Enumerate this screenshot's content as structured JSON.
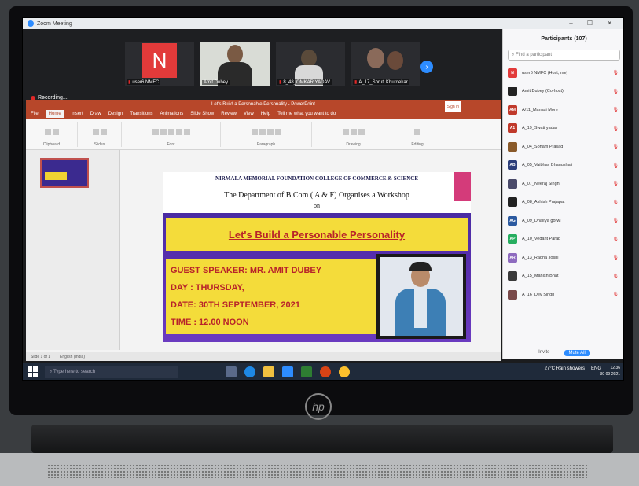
{
  "zoom": {
    "title": "Zoom Meeting",
    "recording": "Recording..."
  },
  "gallery": {
    "tiles": [
      {
        "initial": "N",
        "name": "user6 NMFC"
      },
      {
        "name": "Amit Dubey"
      },
      {
        "name": "8_48_OMKAR YADAV"
      },
      {
        "name": "A_17_Shruti Khurdekar"
      }
    ]
  },
  "ppt": {
    "window_title": "Let's Build a Personable Personality - PowerPoint",
    "signin": "Sign in",
    "tabs": [
      "File",
      "Home",
      "Insert",
      "Draw",
      "Design",
      "Transitions",
      "Animations",
      "Slide Show",
      "Review",
      "View",
      "Help",
      "Tell me what you want to do"
    ],
    "ribbon_groups": [
      "Clipboard",
      "Slides",
      "Font",
      "Paragraph",
      "Drawing",
      "Editing"
    ],
    "status": [
      "Slide 1 of 1",
      "English (India)"
    ]
  },
  "slide": {
    "college": "NIRMALA MEMORIAL FOUNDATION COLLEGE OF COMMERCE & SCIENCE",
    "dept": "The Department of B.Com ( A & F) Organises a Workshop",
    "on": "on",
    "workshop": "Let's Build a Personable Personality",
    "guest": "GUEST SPEAKER:  MR. AMIT DUBEY",
    "day": "DAY : THURSDAY,",
    "date": "DATE: 30TH SEPTEMBER, 2021",
    "time": "TIME : 12.00 NOON"
  },
  "participants": {
    "title": "Participants (107)",
    "search_placeholder": "Find a participant",
    "list": [
      {
        "initials": "N",
        "name": "user6 NMFC (Host, me)",
        "color": "#e23a3a"
      },
      {
        "initials": "",
        "name": "Amit Dubey (Co-host)",
        "color": "#222222"
      },
      {
        "initials": "AM",
        "name": "A/11_Manasi More",
        "color": "#c0392b"
      },
      {
        "initials": "A1",
        "name": "A_19_Swati yadav",
        "color": "#c0392b"
      },
      {
        "initials": "",
        "name": "A_04_Soham Prasad",
        "color": "#8a5a2a"
      },
      {
        "initials": "AB",
        "name": "A_05_Vaibhav Bhanushali",
        "color": "#2c3e7a"
      },
      {
        "initials": "",
        "name": "A_07_Neeraj Singh",
        "color": "#4a4a6a"
      },
      {
        "initials": "",
        "name": "A_08_Ashish Prajapat",
        "color": "#222222"
      },
      {
        "initials": "AG",
        "name": "A_09_Dhairya gorwi",
        "color": "#2c5aa0"
      },
      {
        "initials": "AP",
        "name": "A_10_Vedant Parab",
        "color": "#27ae60"
      },
      {
        "initials": "AR",
        "name": "A_13_Radha Joshi",
        "color": "#8e6bbf"
      },
      {
        "initials": "",
        "name": "A_15_Manish Bhat",
        "color": "#3a3a3a"
      },
      {
        "initials": "",
        "name": "A_16_Dev Singh",
        "color": "#7a4a4a"
      }
    ],
    "invite": "Invite",
    "mute_all": "Mute All"
  },
  "taskbar": {
    "search_placeholder": "Type here to search",
    "weather": "27°C  Rain showers",
    "lang": "ENG",
    "time": "12:36",
    "date": "30-09-2021"
  },
  "laptop": {
    "brand": "hp"
  }
}
